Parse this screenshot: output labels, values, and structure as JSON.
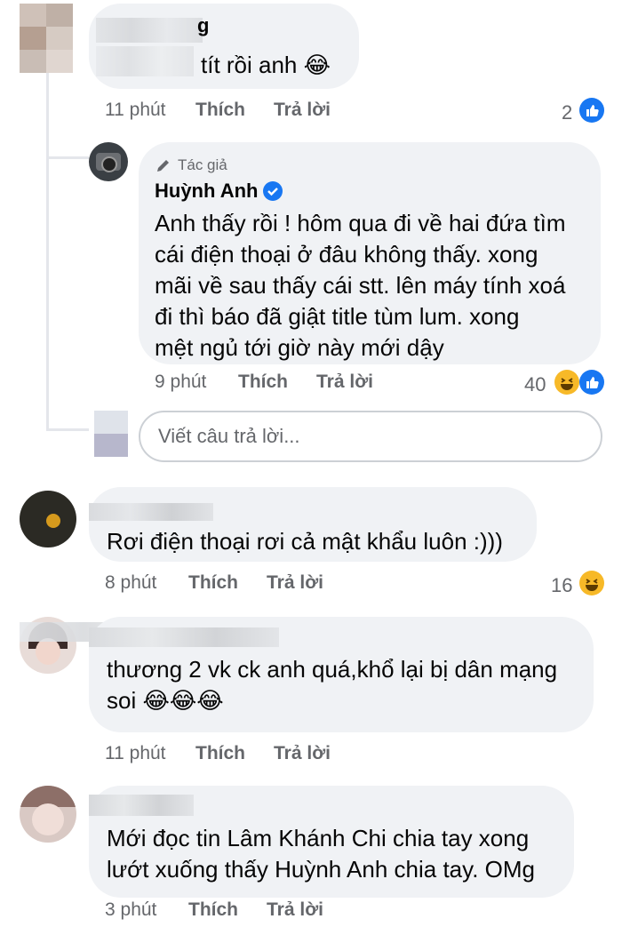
{
  "comments": [
    {
      "text": "tít rồi anh 😂",
      "time": "11 phút",
      "like_label": "Thích",
      "reply_label": "Trả lời",
      "reaction_count": "2",
      "reactions": [
        "like-icon"
      ]
    },
    {
      "author_badge": "Tác giả",
      "author_name": "Huỳnh Anh",
      "verified": true,
      "text": "Anh thấy rồi ! hôm qua đi về hai đứa tìm\ncái điện thoại ở đâu không thấy. xong\nmãi về sau thấy cái stt. lên máy tính xoá\nđi thì báo đã giật title tùm lum. xong\nmệt ngủ tới giờ này mới dậy",
      "time": "9 phút",
      "like_label": "Thích",
      "reply_label": "Trả lời",
      "reaction_count": "40",
      "reactions": [
        "haha-icon",
        "like-icon"
      ]
    },
    {
      "text": "Rơi điện thoại rơi cả mật khẩu luôn :)))",
      "time": "8 phút",
      "like_label": "Thích",
      "reply_label": "Trả lời",
      "reaction_count": "16",
      "reactions": [
        "haha-icon"
      ]
    },
    {
      "text": "thương 2 vk ck anh quá,khổ lại bị dân mạng\nsoi 😂😂😂",
      "time": "11 phút",
      "like_label": "Thích",
      "reply_label": "Trả lời"
    },
    {
      "text": "Mới đọc tin Lâm Khánh Chi chia tay xong\nlướt xuống thấy Huỳnh Anh chia tay. OMg",
      "time": "3 phút",
      "like_label": "Thích",
      "reply_label": "Trả lời"
    }
  ],
  "reply_box": {
    "placeholder": "Viết câu trả lời..."
  },
  "colors": {
    "bubble": "#f0f2f5",
    "meta": "#65676b",
    "like_blue": "#1877f2",
    "haha_yellow": "#f7b928"
  }
}
